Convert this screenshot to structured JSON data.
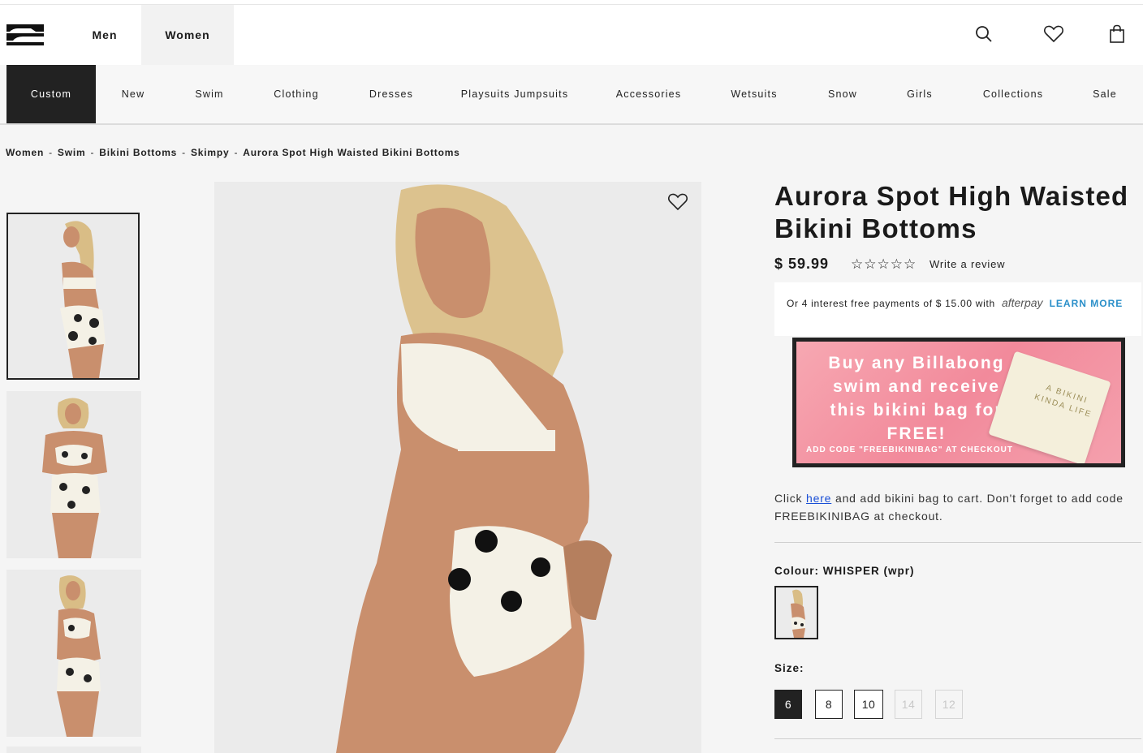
{
  "header": {
    "brand": "Billabong",
    "tabs": [
      {
        "label": "Men"
      },
      {
        "label": "Women",
        "active": true
      }
    ]
  },
  "nav": {
    "items": [
      "Custom",
      "New",
      "Swim",
      "Clothing",
      "Dresses",
      "Playsuits Jumpsuits",
      "Accessories",
      "Wetsuits",
      "Snow",
      "Girls",
      "Collections",
      "Sale"
    ]
  },
  "breadcrumb": [
    "Women",
    "Swim",
    "Bikini Bottoms",
    "Skimpy",
    "Aurora Spot High Waisted Bikini Bottoms"
  ],
  "product": {
    "title": "Aurora Spot High Waisted Bikini Bottoms",
    "price": "$ 59.99",
    "rating_stars": "☆☆☆☆☆",
    "write_review": "Write a review",
    "afterpay_text": "Or 4 interest free payments of $ 15.00 with",
    "afterpay_logo": "afterpay",
    "afterpay_link": "LEARN MORE",
    "promo_headline": "Buy any Billabong swim and receive this bikini bag for FREE!",
    "promo_code": "ADD CODE \"FREEBIKINIBAG\" AT CHECKOUT",
    "promo_bag_text": "A BIKINI KINDA LIFE",
    "click_prefix": "Click",
    "click_link": "here",
    "click_suffix": "and add bikini bag to cart. Don't forget to add code FREEBIKINIBAG at checkout.",
    "colour_label": "Colour: WHISPER (wpr)",
    "size_label": "Size:",
    "sizes": [
      {
        "label": "6",
        "state": "selected"
      },
      {
        "label": "8",
        "state": "available"
      },
      {
        "label": "10",
        "state": "available"
      },
      {
        "label": "14",
        "state": "disabled"
      },
      {
        "label": "12",
        "state": "disabled"
      }
    ]
  },
  "colors": {
    "dark": "#222222",
    "link_blue": "#2a8fc9",
    "promo_pink": "#f28a9b",
    "page_bg": "#f5f5f5"
  }
}
